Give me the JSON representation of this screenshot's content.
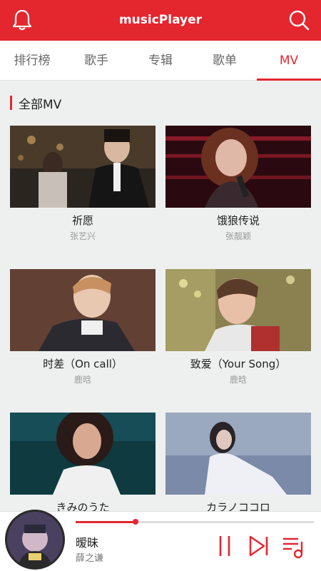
{
  "app": {
    "title": "musicPlayer"
  },
  "icons": {
    "left": "bell-icon",
    "right": "search-icon"
  },
  "colors": {
    "accent": "#e4262f"
  },
  "tabs": [
    {
      "label": "排行榜",
      "active": false
    },
    {
      "label": "歌手",
      "active": false
    },
    {
      "label": "专辑",
      "active": false
    },
    {
      "label": "歌单",
      "active": false
    },
    {
      "label": "MV",
      "active": true
    }
  ],
  "section": {
    "title": "全部MV"
  },
  "mvs": [
    {
      "title": "祈愿",
      "artist": "张艺兴"
    },
    {
      "title": "饿狼传说",
      "artist": "张靓颖"
    },
    {
      "title": "时差（On call）",
      "artist": "鹿晗"
    },
    {
      "title": "致爱（Your Song）",
      "artist": "鹿晗"
    },
    {
      "title": "きみのうた",
      "artist": ""
    },
    {
      "title": "カラノココロ",
      "artist": ""
    }
  ],
  "player": {
    "song": "暧昧",
    "artist": "薛之谦",
    "progress": 0.25,
    "controls": [
      "pause-icon",
      "next-icon",
      "playlist-icon"
    ]
  }
}
